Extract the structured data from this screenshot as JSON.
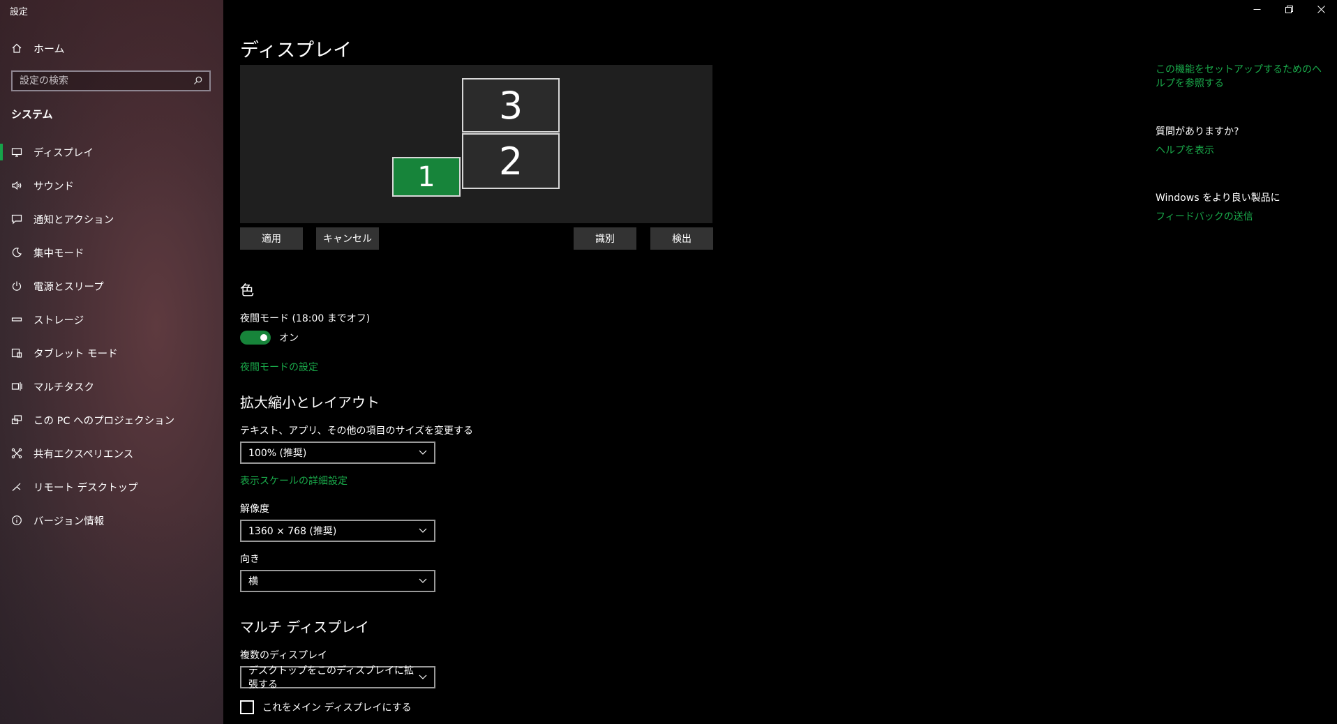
{
  "window": {
    "title": "設定",
    "controls": {
      "minimize_icon": "minimize-icon",
      "restore_icon": "restore-icon",
      "close_icon": "close-icon"
    }
  },
  "sidebar": {
    "home_label": "ホーム",
    "search_placeholder": "設定の検索",
    "section_title": "システム",
    "items": [
      {
        "label": "ディスプレイ",
        "icon": "display-icon",
        "active": true
      },
      {
        "label": "サウンド",
        "icon": "speaker-icon"
      },
      {
        "label": "通知とアクション",
        "icon": "notification-icon"
      },
      {
        "label": "集中モード",
        "icon": "moon-icon"
      },
      {
        "label": "電源とスリープ",
        "icon": "power-icon"
      },
      {
        "label": "ストレージ",
        "icon": "storage-icon"
      },
      {
        "label": "タブレット モード",
        "icon": "tablet-icon"
      },
      {
        "label": "マルチタスク",
        "icon": "multitask-icon"
      },
      {
        "label": "この PC へのプロジェクション",
        "icon": "projection-icon"
      },
      {
        "label": "共有エクスペリエンス",
        "icon": "shared-icon"
      },
      {
        "label": "リモート デスクトップ",
        "icon": "remote-icon"
      },
      {
        "label": "バージョン情報",
        "icon": "info-icon"
      }
    ]
  },
  "main": {
    "title": "ディスプレイ",
    "monitors": {
      "m3": "3",
      "m2": "2",
      "m1": "1"
    },
    "buttons": {
      "apply": "適用",
      "cancel": "キャンセル",
      "identify": "識別",
      "detect": "検出"
    },
    "color": {
      "heading": "色",
      "night_mode_label": "夜間モード (18:00 までオフ)",
      "night_mode_state": "オン",
      "night_mode_link": "夜間モードの設定"
    },
    "scale": {
      "heading": "拡大縮小とレイアウト",
      "size_label": "テキスト、アプリ、その他の項目のサイズを変更する",
      "size_value": "100% (推奨)",
      "advanced_link": "表示スケールの詳細設定",
      "resolution_label": "解像度",
      "resolution_value": "1360 × 768 (推奨)",
      "orientation_label": "向き",
      "orientation_value": "横"
    },
    "multi": {
      "heading": "マルチ ディスプレイ",
      "label": "複数のディスプレイ",
      "value": "デスクトップをこのディスプレイに拡張する",
      "main_display_checkbox": "これをメイン ディスプレイにする"
    }
  },
  "help": {
    "setup_link": "この機能をセットアップするためのヘルプを参照する",
    "question": "質問がありますか?",
    "help_link": "ヘルプを表示",
    "improve": "Windows をより良い製品に",
    "feedback_link": "フィードバックの送信"
  },
  "colors": {
    "accent": "#17843a",
    "link": "#1aab4b"
  }
}
